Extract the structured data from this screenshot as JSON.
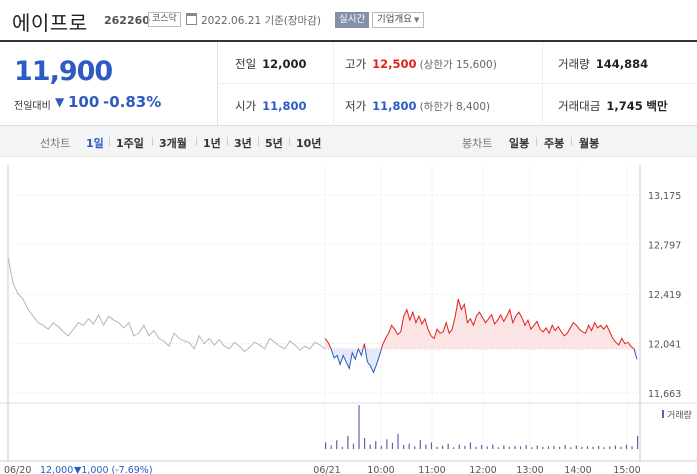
{
  "header": {
    "title": "에이프로",
    "code": "262260",
    "market": "코스닥",
    "date": "2022.06.21 기준(장마감)",
    "realtime_label": "실시간",
    "company_label": "기업개요"
  },
  "quote": {
    "price": "11,900",
    "change_label": "전일대비",
    "change_value": "100",
    "change_rate": "-0.83%",
    "prev_label": "전일",
    "prev_value": "12,000",
    "high_label": "고가",
    "high_value": "12,500",
    "upper_limit": "(상한가 15,600)",
    "volume_label": "거래량",
    "volume_value": "144,884",
    "open_label": "시가",
    "open_value": "11,800",
    "low_label": "저가",
    "low_value": "11,800",
    "lower_limit": "(하한가 8,400)",
    "amount_label": "거래대금",
    "amount_value": "1,745",
    "amount_unit": "백만"
  },
  "tabs": {
    "line_label": "선차트",
    "line_tabs": [
      "1일",
      "1주일",
      "3개월",
      "1년",
      "3년",
      "5년",
      "10년"
    ],
    "active_tab": "1일",
    "candle_label": "봉차트",
    "candle_tabs": [
      "일봉",
      "주봉",
      "월봉"
    ]
  },
  "chart_data": {
    "type": "line",
    "y_ticks": [
      "13,175",
      "12,797",
      "12,419",
      "12,041",
      "11,663"
    ],
    "ylim": [
      11663,
      13175
    ],
    "prev_close": 12000,
    "x_ticks": [
      "06/21",
      "10:00",
      "11:00",
      "12:00",
      "13:00",
      "14:00",
      "15:00"
    ],
    "prev_day_label": "06/20",
    "prev_day_price": "12,000",
    "prev_day_change": "▼1,000 (-7.69%)",
    "volume_legend": "거래량",
    "colors": {
      "up": "#e0211c",
      "down": "#2d5bc3",
      "prev_day": "#b5b5b5",
      "volume": "#6e5ba6"
    },
    "prev_day_series": [
      12700,
      12500,
      12420,
      12380,
      12300,
      12250,
      12200,
      12180,
      12150,
      12200,
      12170,
      12130,
      12100,
      12150,
      12200,
      12180,
      12230,
      12190,
      12260,
      12180,
      12250,
      12220,
      12200,
      12160,
      12200,
      12100,
      12120,
      12180,
      12100,
      12140,
      12080,
      12060,
      12020,
      12120,
      12080,
      12060,
      12050,
      12000,
      12100,
      12040,
      12080,
      12030,
      12070,
      12020,
      12000,
      12050,
      12020,
      11980,
      12010,
      12050,
      12030,
      12000,
      12080,
      12050,
      12020,
      12000,
      12060,
      12030,
      11990,
      12020,
      12000,
      12050,
      12030,
      12000
    ],
    "today_series": [
      12080,
      12050,
      12000,
      11930,
      11950,
      11880,
      11950,
      11900,
      11850,
      11970,
      11920,
      12000,
      11950,
      12040,
      11900,
      11870,
      11820,
      11880,
      11950,
      12030,
      12080,
      12120,
      12180,
      12150,
      12110,
      12130,
      12250,
      12300,
      12220,
      12280,
      12200,
      12250,
      12190,
      12230,
      12150,
      12100,
      12080,
      12150,
      12120,
      12130,
      12200,
      12120,
      12150,
      12250,
      12380,
      12300,
      12340,
      12200,
      12230,
      12180,
      12250,
      12280,
      12240,
      12200,
      12230,
      12260,
      12190,
      12220,
      12260,
      12210,
      12250,
      12300,
      12200,
      12250,
      12280,
      12240,
      12180,
      12220,
      12150,
      12180,
      12210,
      12150,
      12130,
      12160,
      12120,
      12180,
      12140,
      12170,
      12130,
      12100,
      12120,
      12160,
      12200,
      12180,
      12150,
      12130,
      12120,
      12180,
      12140,
      12200,
      12160,
      12180,
      12150,
      12180,
      12130,
      12080,
      12050,
      12030,
      12080,
      12040,
      12050,
      12020,
      12000,
      11920
    ],
    "volume_bars": [
      0.15,
      0.08,
      0.2,
      0.05,
      0.3,
      0.12,
      1.0,
      0.25,
      0.1,
      0.18,
      0.07,
      0.22,
      0.14,
      0.35,
      0.09,
      0.12,
      0.06,
      0.2,
      0.1,
      0.15,
      0.05,
      0.08,
      0.12,
      0.04,
      0.1,
      0.07,
      0.15,
      0.05,
      0.09,
      0.06,
      0.1,
      0.04,
      0.08,
      0.05,
      0.07,
      0.06,
      0.09,
      0.04,
      0.08,
      0.05,
      0.06,
      0.07,
      0.05,
      0.09,
      0.04,
      0.08,
      0.05,
      0.06,
      0.05,
      0.07,
      0.04,
      0.06,
      0.08,
      0.05,
      0.1,
      0.06,
      0.3
    ]
  }
}
